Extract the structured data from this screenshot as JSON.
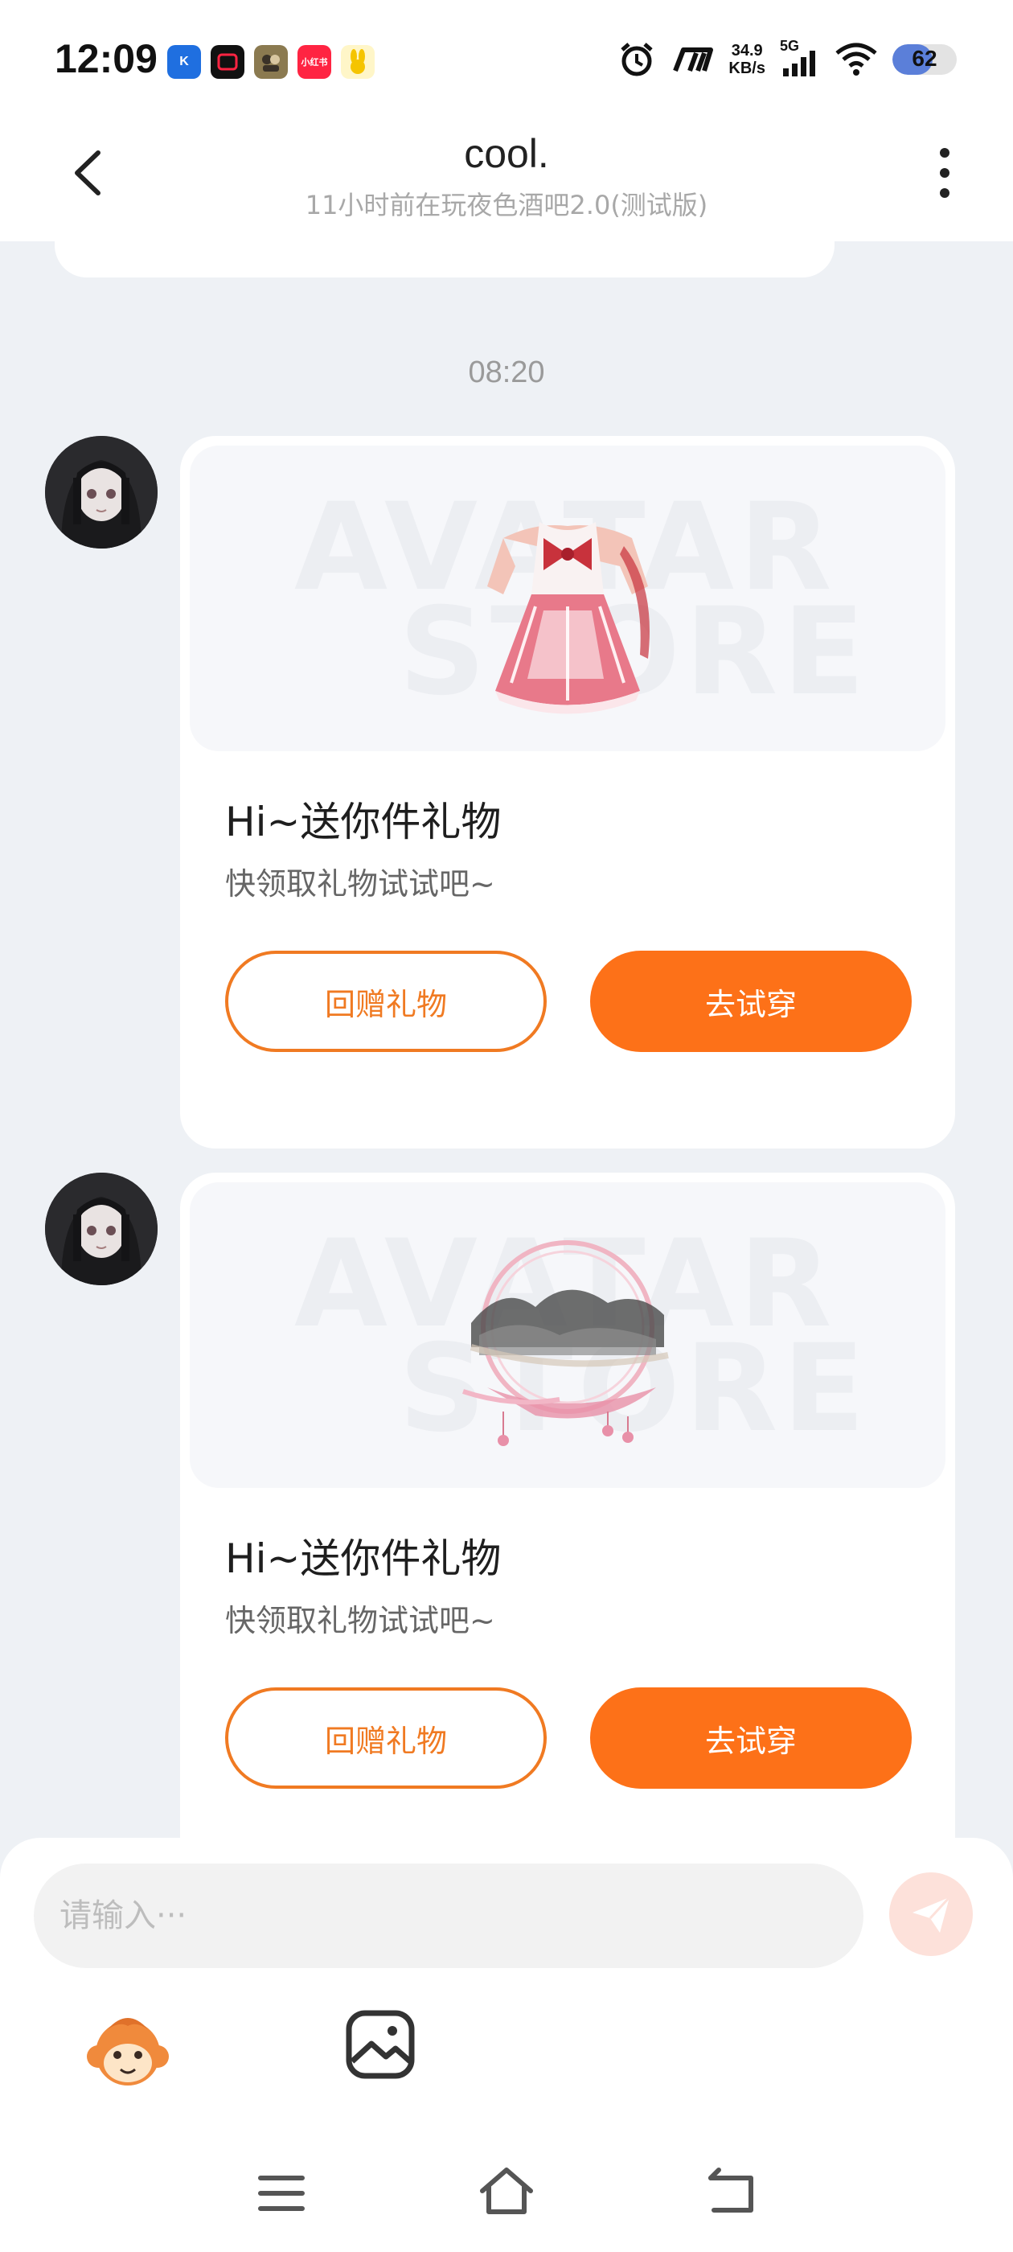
{
  "status_bar": {
    "time": "12:09",
    "app_icons": [
      {
        "name": "k-app-icon",
        "label": "K",
        "color": "#1f6fe0"
      },
      {
        "name": "video-app-icon",
        "label": "▣",
        "color": "#111111"
      },
      {
        "name": "game-app-icon",
        "label": "♟",
        "color": "#7a6a3a"
      },
      {
        "name": "xiaohongshu-app-icon",
        "label": "小红书",
        "color": "#ff2442"
      },
      {
        "name": "rabbit-app-icon",
        "label": "🐰",
        "color": "#ffd84a"
      }
    ],
    "net_speed_value": "34.9",
    "net_speed_unit": "KB/s",
    "network": "5G",
    "battery": "62",
    "battery_level": 0.62
  },
  "header": {
    "title": "cool.",
    "subtitle": "11小时前在玩夜色酒吧2.0(测试版)"
  },
  "chat": {
    "timestamp": "08:20",
    "watermark_line1": "AVATAR",
    "watermark_line2": "STORE",
    "messages": [
      {
        "gift_title": "Hi~送你件礼物",
        "gift_desc": "快领取礼物试试吧~",
        "return_label": "回赠礼物",
        "try_label": "去试穿",
        "item": "dress-icon"
      },
      {
        "gift_title": "Hi~送你件礼物",
        "gift_desc": "快领取礼物试试吧~",
        "return_label": "回赠礼物",
        "try_label": "去试穿",
        "item": "ink-frame-icon"
      }
    ]
  },
  "input": {
    "placeholder": "请输入···"
  },
  "colors": {
    "accent": "#fd7118",
    "accent_outline": "#f07a22",
    "background": "#eef1f5"
  }
}
